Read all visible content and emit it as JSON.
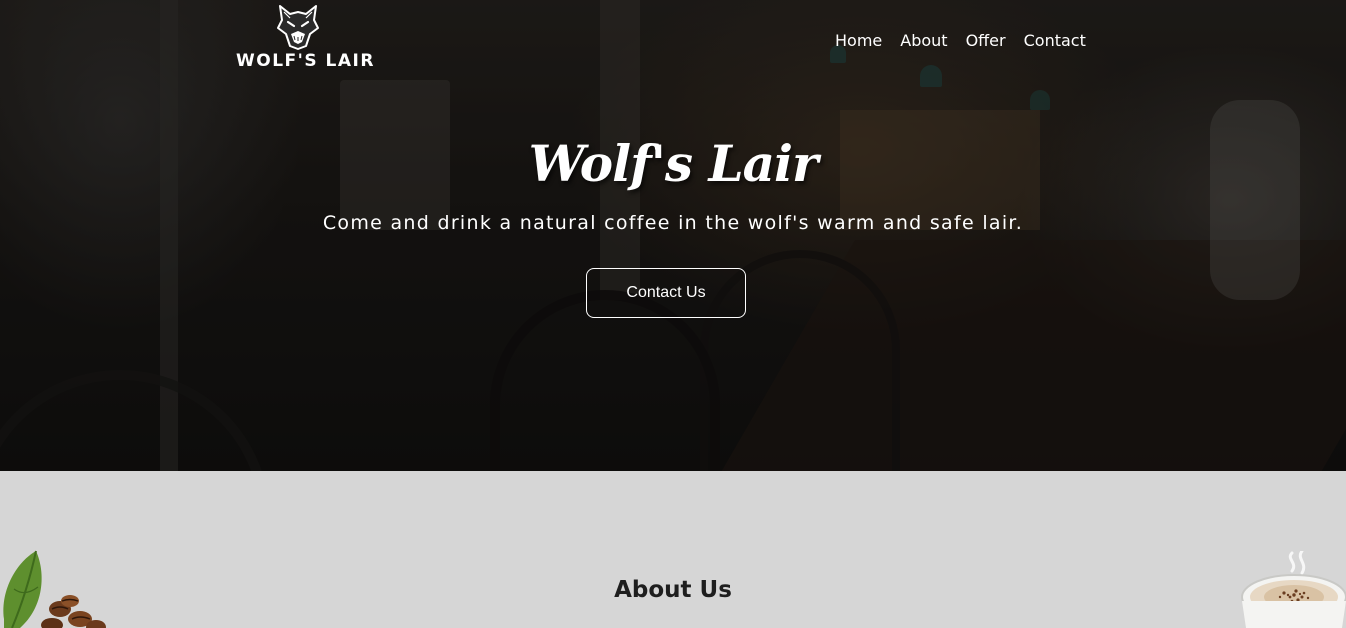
{
  "header": {
    "logo_text": "WOLF'S LAIR",
    "nav": [
      {
        "label": "Home"
      },
      {
        "label": "About"
      },
      {
        "label": "Offer"
      },
      {
        "label": "Contact"
      }
    ]
  },
  "hero": {
    "title": "Wolf's Lair",
    "subtitle": "Come and drink a natural coffee in the wolf's warm and safe lair.",
    "cta_label": "Contact Us"
  },
  "about": {
    "title": "About Us"
  },
  "icons": [
    "wolf-logo-icon",
    "coffee-beans-image",
    "coffee-cup-image"
  ],
  "colors": {
    "hero_overlay": "#1e1b18",
    "text_light": "#ffffff",
    "section_bg": "#d6d6d6",
    "heading_dark": "#1e1e1e"
  }
}
